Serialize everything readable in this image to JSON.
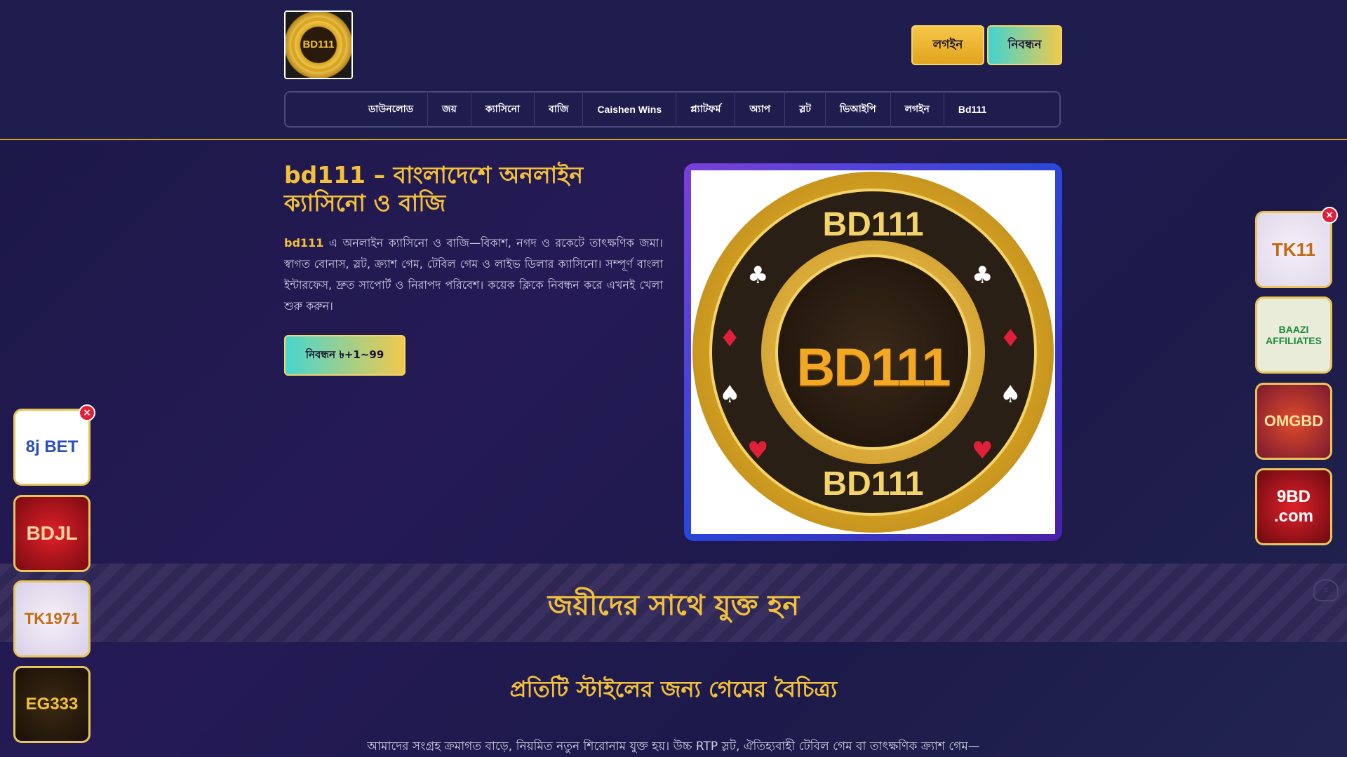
{
  "header": {
    "logo_text": "BD111",
    "login_label": "লগইন",
    "register_label": "নিবন্ধন"
  },
  "nav": {
    "items": [
      "ডাউনলোড",
      "জয়",
      "ক্যাসিনো",
      "বাজি",
      "Caishen Wins",
      "প্ল্যাটফর্ম",
      "অ্যাপ",
      "স্লট",
      "ভিআইপি",
      "লগইন",
      "Bd111"
    ]
  },
  "hero": {
    "title": "bd111 – বাংলাদেশে অনলাইন ক্যাসিনো ও বাজি",
    "brand": "bd111",
    "text": " এ অনলাইন ক্যাসিনো ও বাজি—বিকাশ, নগদ ও রকেটে তাৎক্ষণিক জমা। স্বাগত বোনাস, স্লট, ক্র্যাশ গেম, টেবিল গেম ও লাইভ ডিলার ক্যাসিনো। সম্পূর্ণ বাংলা ইন্টারফেস, দ্রুত সাপোর্ট ও নিরাপদ পরিবেশ। কয়েক ক্লিকে নিবন্ধন করে এখনই খেলা শুরু করুন।",
    "cta_label": "নিবন্ধন ৳+1~99",
    "image": {
      "top": "BD111",
      "center": "BD111",
      "bottom": "BD111"
    }
  },
  "strip": {
    "title": "জয়ীদের সাথে যুক্ত হন"
  },
  "section": {
    "title": "প্রতিটি স্টাইলের জন্য গেমের বৈচিত্র্য",
    "text": "আমাদের সংগ্রহ ক্রমাগত বাড়ে, নিয়মিত নতুন শিরোনাম যুক্ত হয়। উচ্চ RTP স্লট, ঐতিহ্যবাহী টেবিল গেম বা তাৎক্ষণিক ক্র্যাশ গেম—"
  },
  "ads": {
    "close_label": "×",
    "left": [
      "8j BET",
      "BDJL",
      "TK1971",
      "EG333"
    ],
    "right": [
      "TK11",
      "BAAZI AFFILIATES",
      "OMGBD",
      "9BD .com"
    ]
  },
  "colors": {
    "accent": "#f2c03a",
    "background": "#1f1d4d",
    "teal": "#3ed3d2"
  }
}
